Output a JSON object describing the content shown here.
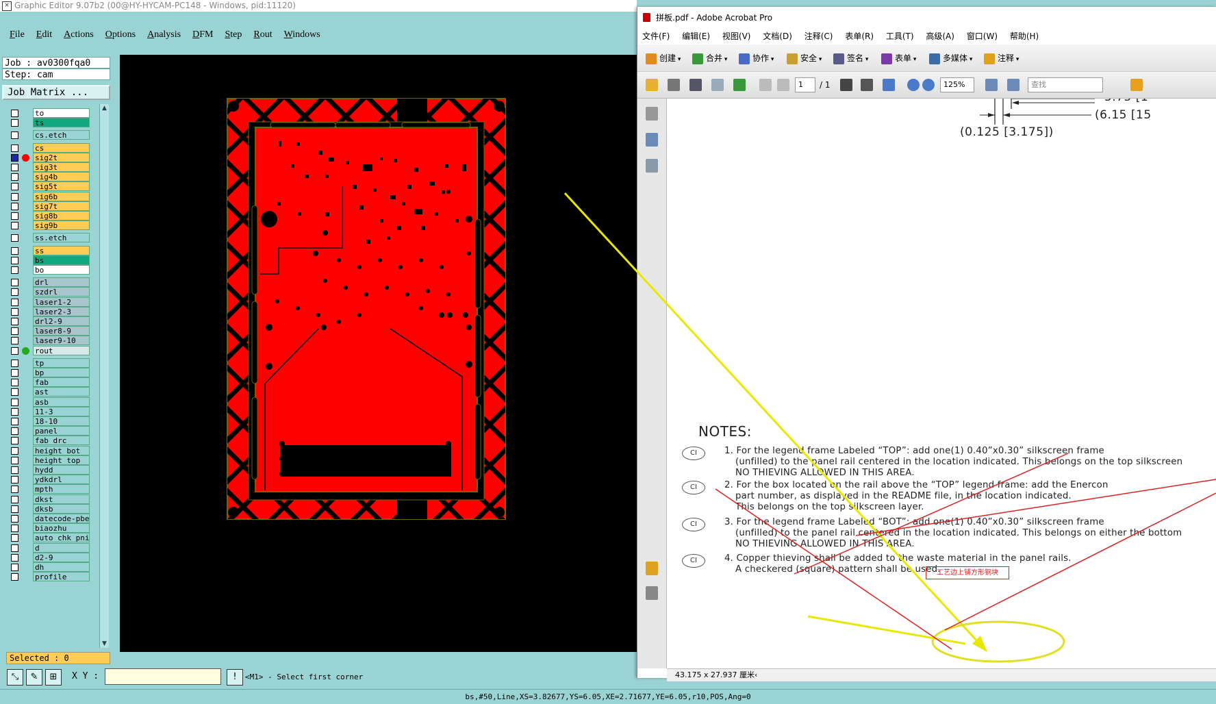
{
  "graphic_editor": {
    "title": "Graphic Editor 9.07b2 (00@HY-HYCAM-PC148 - Windows, pid:11120)",
    "menu": [
      "File",
      "Edit",
      "Actions",
      "Options",
      "Analysis",
      "DFM",
      "Step",
      "Rout",
      "Windows"
    ],
    "job": "Job : av0300fqa0",
    "step": "Step: cam",
    "job_matrix": "Job Matrix ...",
    "layers": [
      {
        "name": "to",
        "color": "#ffffff"
      },
      {
        "name": "ts",
        "color": "#10a880"
      },
      {
        "name": "cs.etch",
        "color": "#9ad3d3"
      },
      {
        "name": "cs",
        "color": "#ffcc55"
      },
      {
        "name": "sig2t",
        "color": "#ffcc55",
        "active": true,
        "dot": "#ff0000"
      },
      {
        "name": "sig3t",
        "color": "#ffcc55"
      },
      {
        "name": "sig4b",
        "color": "#ffcc55"
      },
      {
        "name": "sig5t",
        "color": "#ffcc55"
      },
      {
        "name": "sig6b",
        "color": "#ffcc55"
      },
      {
        "name": "sig7t",
        "color": "#ffcc55"
      },
      {
        "name": "sig8b",
        "color": "#ffcc55"
      },
      {
        "name": "sig9b",
        "color": "#ffcc55"
      },
      {
        "name": "ss.etch",
        "color": "#9ad3d3"
      },
      {
        "name": "ss",
        "color": "#ffcc55"
      },
      {
        "name": "bs",
        "color": "#10a880"
      },
      {
        "name": "bo",
        "color": "#ffffff"
      },
      {
        "name": "drl",
        "color": "#a8c4cc"
      },
      {
        "name": "szdrl",
        "color": "#a8c4cc"
      },
      {
        "name": "laser1-2",
        "color": "#a8c4cc"
      },
      {
        "name": "laser2-3",
        "color": "#a8c4cc"
      },
      {
        "name": "drl2-9",
        "color": "#a8c4cc"
      },
      {
        "name": "laser8-9",
        "color": "#a8c4cc"
      },
      {
        "name": "laser9-10",
        "color": "#a8c4cc"
      },
      {
        "name": "rout",
        "color": "#d8e8e8",
        "dot": "#22aa22"
      },
      {
        "name": "tp",
        "color": "#9ad3d3"
      },
      {
        "name": "bp",
        "color": "#9ad3d3"
      },
      {
        "name": "fab",
        "color": "#9ad3d3"
      },
      {
        "name": "ast",
        "color": "#9ad3d3"
      },
      {
        "name": "asb",
        "color": "#9ad3d3"
      },
      {
        "name": "11-3",
        "color": "#9ad3d3"
      },
      {
        "name": "18-10",
        "color": "#9ad3d3"
      },
      {
        "name": "panel",
        "color": "#9ad3d3"
      },
      {
        "name": "fab_drc",
        "color": "#9ad3d3"
      },
      {
        "name": "height_bot",
        "color": "#9ad3d3"
      },
      {
        "name": "height_top",
        "color": "#9ad3d3"
      },
      {
        "name": "hydd",
        "color": "#9ad3d3"
      },
      {
        "name": "ydkdrl",
        "color": "#9ad3d3"
      },
      {
        "name": "mpth",
        "color": "#9ad3d3"
      },
      {
        "name": "dkst",
        "color": "#9ad3d3"
      },
      {
        "name": "dksb",
        "color": "#9ad3d3"
      },
      {
        "name": "datecode-pbe",
        "color": "#9ad3d3"
      },
      {
        "name": "biaozhu",
        "color": "#9ad3d3"
      },
      {
        "name": "auto_chk_pni",
        "color": "#9ad3d3"
      },
      {
        "name": "d",
        "color": "#9ad3d3"
      },
      {
        "name": "d2-9",
        "color": "#9ad3d3"
      },
      {
        "name": "dh",
        "color": "#9ad3d3"
      },
      {
        "name": "profile",
        "color": "#9ad3d3"
      }
    ],
    "selected": "Selected : 0",
    "xy_label": "X Y :",
    "xy_value": "",
    "prompt": "<M1> - Select first corner",
    "status": "bs,#50,Line,XS=3.82677,YS=6.05,XE=2.71677,YE=6.05,r10,POS,Ang=0"
  },
  "acrobat": {
    "title": "拼板.pdf - Adobe Acrobat Pro",
    "menu": [
      "文件(F)",
      "编辑(E)",
      "视图(V)",
      "文档(D)",
      "注释(C)",
      "表单(R)",
      "工具(T)",
      "高级(A)",
      "窗口(W)",
      "帮助(H)"
    ],
    "toolbar": [
      {
        "label": "创建",
        "icon": "create-icon",
        "color": "#e08a20"
      },
      {
        "label": "合并",
        "icon": "combine-icon",
        "color": "#3a9a3a"
      },
      {
        "label": "协作",
        "icon": "collaborate-icon",
        "color": "#4a6ac8"
      },
      {
        "label": "安全",
        "icon": "lock-icon",
        "color": "#c8a030"
      },
      {
        "label": "签名",
        "icon": "pen-icon",
        "color": "#5a5a8a"
      },
      {
        "label": "表单",
        "icon": "form-icon",
        "color": "#7a3aa8"
      },
      {
        "label": "多媒体",
        "icon": "film-icon",
        "color": "#3a6aa8"
      },
      {
        "label": "注释",
        "icon": "comment-icon",
        "color": "#e0a020"
      }
    ],
    "page_current": "1",
    "page_total": "/ 1",
    "zoom": "125%",
    "search_placeholder": "查找",
    "doc": {
      "dim_top1": "5.75 [1",
      "dim_top2": "(6.15 [15",
      "dim_mid": "(0.125 [3.175])",
      "notes_heading": "NOTES:",
      "notes": [
        {
          "badge": "CI",
          "lines": [
            "1. For the legend frame Labeled “TOP”: add one(1) 0.40”x0.30” silkscreen frame",
            "(unfilled) to the panel rail centered in the location indicated. This belongs on the top silkscreen",
            "NO THIEVING ALLOWED IN THIS AREA."
          ]
        },
        {
          "badge": "CI",
          "lines": [
            "2. For the box located on the rail above the “TOP” legend frame: add the Enercon",
            "part number, as displayed in the README file, in the location indicated.",
            "This belongs on the top silkscreen layer."
          ]
        },
        {
          "badge": "CI",
          "lines": [
            "3. For the legend frame Labeled “BOT”: add one(1) 0.40”x0.30” silkscreen frame",
            "(unfilled) to the panel rail centered in the location indicated. This belongs on either the bottom",
            "NO THIEVING ALLOWED IN THIS AREA."
          ]
        },
        {
          "badge": "CI",
          "lines": [
            "4. Copper thieving shall be added to the waste material in the panel rails.",
            "A checkered (square) pattern shall be used."
          ]
        }
      ],
      "stamp": "工艺边上铺方形铜块"
    },
    "status_size": "43.175 x 27.937 厘米"
  }
}
